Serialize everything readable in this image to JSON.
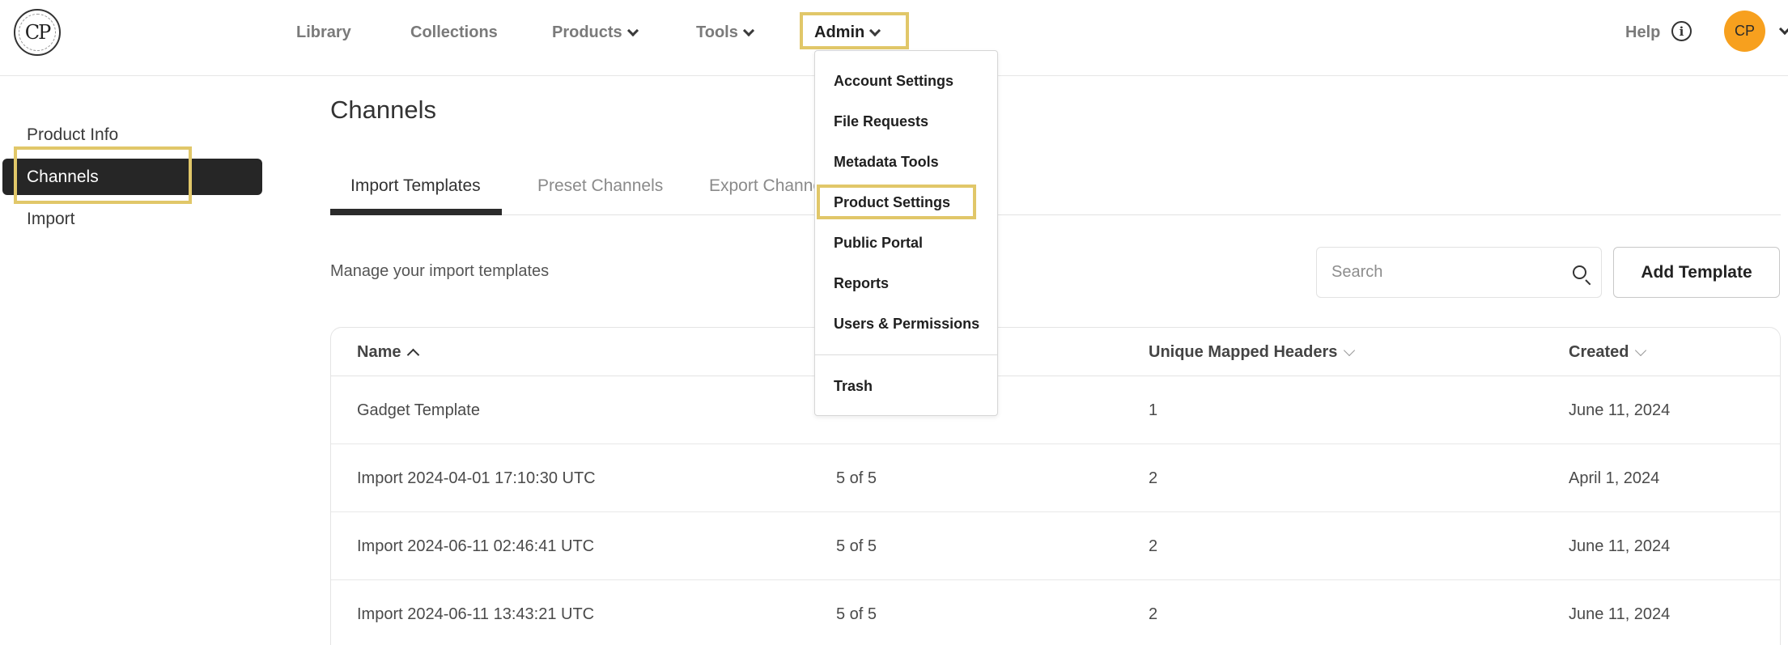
{
  "app": {
    "logo_text": "CP",
    "logo_icon": "brand-monogram-icon"
  },
  "nav": {
    "library": "Library",
    "collections": "Collections",
    "products": "Products",
    "tools": "Tools",
    "admin": "Admin",
    "help": "Help",
    "info_icon": "i",
    "avatar_initials": "CP"
  },
  "admin_menu": {
    "items": [
      "Account Settings",
      "File Requests",
      "Metadata Tools",
      "Product Settings",
      "Public Portal",
      "Reports",
      "Users & Permissions"
    ],
    "trash": "Trash"
  },
  "sidebar": {
    "items": [
      "Product Info",
      "Channels",
      "Import"
    ]
  },
  "main": {
    "title": "Channels",
    "tabs": [
      "Import Templates",
      "Preset Channels",
      "Export Channels"
    ],
    "subtitle": "Manage your import templates",
    "search_placeholder": "Search",
    "add_button": "Add Template"
  },
  "table": {
    "headers": [
      "Name",
      "Unique Mapped Headers",
      "Created"
    ],
    "rows": [
      {
        "name": "Gadget Template",
        "mapped": "",
        "unique": "1",
        "created": "June 11, 2024"
      },
      {
        "name": "Import 2024-04-01 17:10:30 UTC",
        "mapped": "5 of 5",
        "unique": "2",
        "created": "April 1, 2024"
      },
      {
        "name": "Import 2024-06-11 02:46:41 UTC",
        "mapped": "5 of 5",
        "unique": "2",
        "created": "June 11, 2024"
      },
      {
        "name": "Import 2024-06-11 13:43:21 UTC",
        "mapped": "5 of 5",
        "unique": "2",
        "created": "June 11, 2024"
      }
    ]
  },
  "colors": {
    "highlight": "#e1c769",
    "avatar": "#f7a01e",
    "active_sidebar": "#262626"
  }
}
